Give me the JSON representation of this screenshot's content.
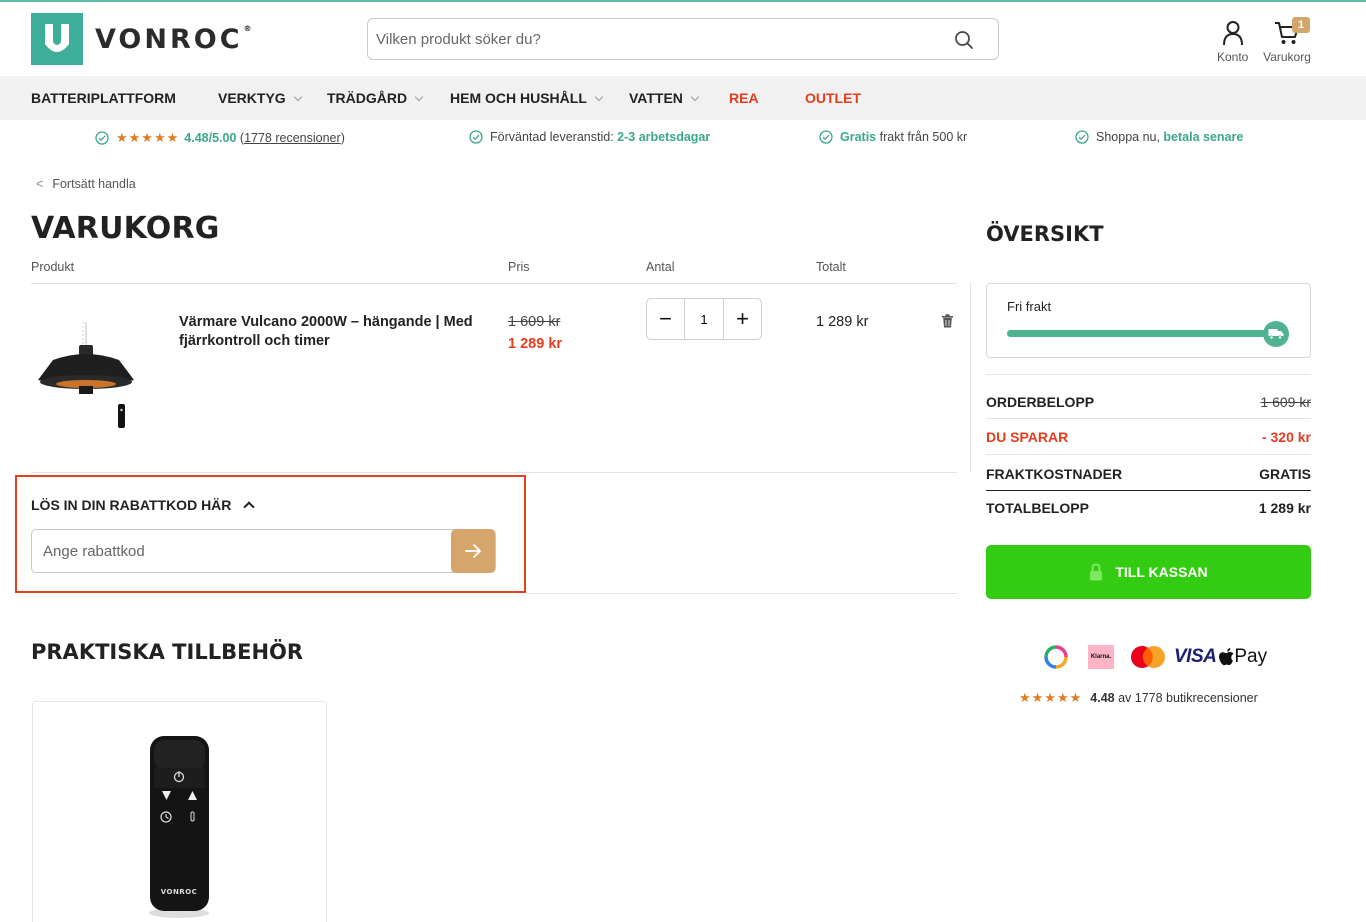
{
  "brand": {
    "name": "VONROC",
    "reg": "®"
  },
  "search": {
    "placeholder": "Vilken produkt söker du?"
  },
  "header": {
    "account_label": "Konto",
    "cart_label": "Varukorg",
    "cart_count": "1"
  },
  "nav": {
    "items": [
      {
        "label": "BATTERIPLATTFORM"
      },
      {
        "label": "VERKTYG"
      },
      {
        "label": "TRÄDGÅRD"
      },
      {
        "label": "HEM OCH HUSHÅLL"
      },
      {
        "label": "VATTEN"
      },
      {
        "label": "REA"
      },
      {
        "label": "OUTLET"
      }
    ]
  },
  "usp": {
    "rating_stars": "★★★★★",
    "rating_value": "4.48/5.00",
    "rating_open": "(",
    "rating_count": "1778 recensioner",
    "rating_close": ")",
    "delivery_text": "Förväntad leveranstid: ",
    "delivery_hl": "2-3 arbetsdagar",
    "freight_hl": "Gratis",
    "freight_text": " frakt från 500 kr",
    "pay_text": "Shoppa nu, ",
    "pay_hl": "betala senare"
  },
  "breadcrumb": {
    "back": "Fortsätt handla"
  },
  "cart": {
    "title": "VARUKORG",
    "columns": {
      "product": "Produkt",
      "price": "Pris",
      "qty": "Antal",
      "total": "Totalt"
    },
    "item": {
      "name": "Värmare Vulcano 2000W – hängande | Med fjärrkontroll och timer",
      "old_price": "1 609 kr",
      "price": "1 289 kr",
      "qty": "1",
      "total": "1 289 kr"
    },
    "qty_minus": "−",
    "qty_plus": "+"
  },
  "coupon": {
    "title": "LÖS IN DIN RABATTKOD HÄR",
    "placeholder": "Ange rabattkod"
  },
  "accessories": {
    "title": "PRAKTISKA TILLBEHÖR",
    "remote_brand": "VONROC"
  },
  "summary": {
    "title": "ÖVERSIKT",
    "free_shipping_label": "Fri frakt",
    "free_shipping_progress": 1.0,
    "rows": [
      {
        "label": "ORDERBELOPP",
        "value": "1 609 kr"
      },
      {
        "label": "DU SPARAR",
        "value": "- 320 kr"
      },
      {
        "label": "FRAKTKOSTNADER",
        "value": "GRATIS"
      },
      {
        "label": "TOTALBELOPP",
        "value": "1 289 kr"
      }
    ],
    "checkout_label": "TILL KASSAN",
    "klarna_label": "Klarna.",
    "visa_label": "VISA",
    "apple_pay_label": "Pay",
    "review_stars": "★★★★★",
    "review_score": "4.48",
    "review_text": " av 1778 butikrecensioner"
  },
  "colors": {
    "brand_teal": "#3dae9a",
    "accent_red": "#e63c1e",
    "checkout_green": "#34cc12",
    "gold": "#d5a56b",
    "highlight_border": "#e0431d"
  }
}
